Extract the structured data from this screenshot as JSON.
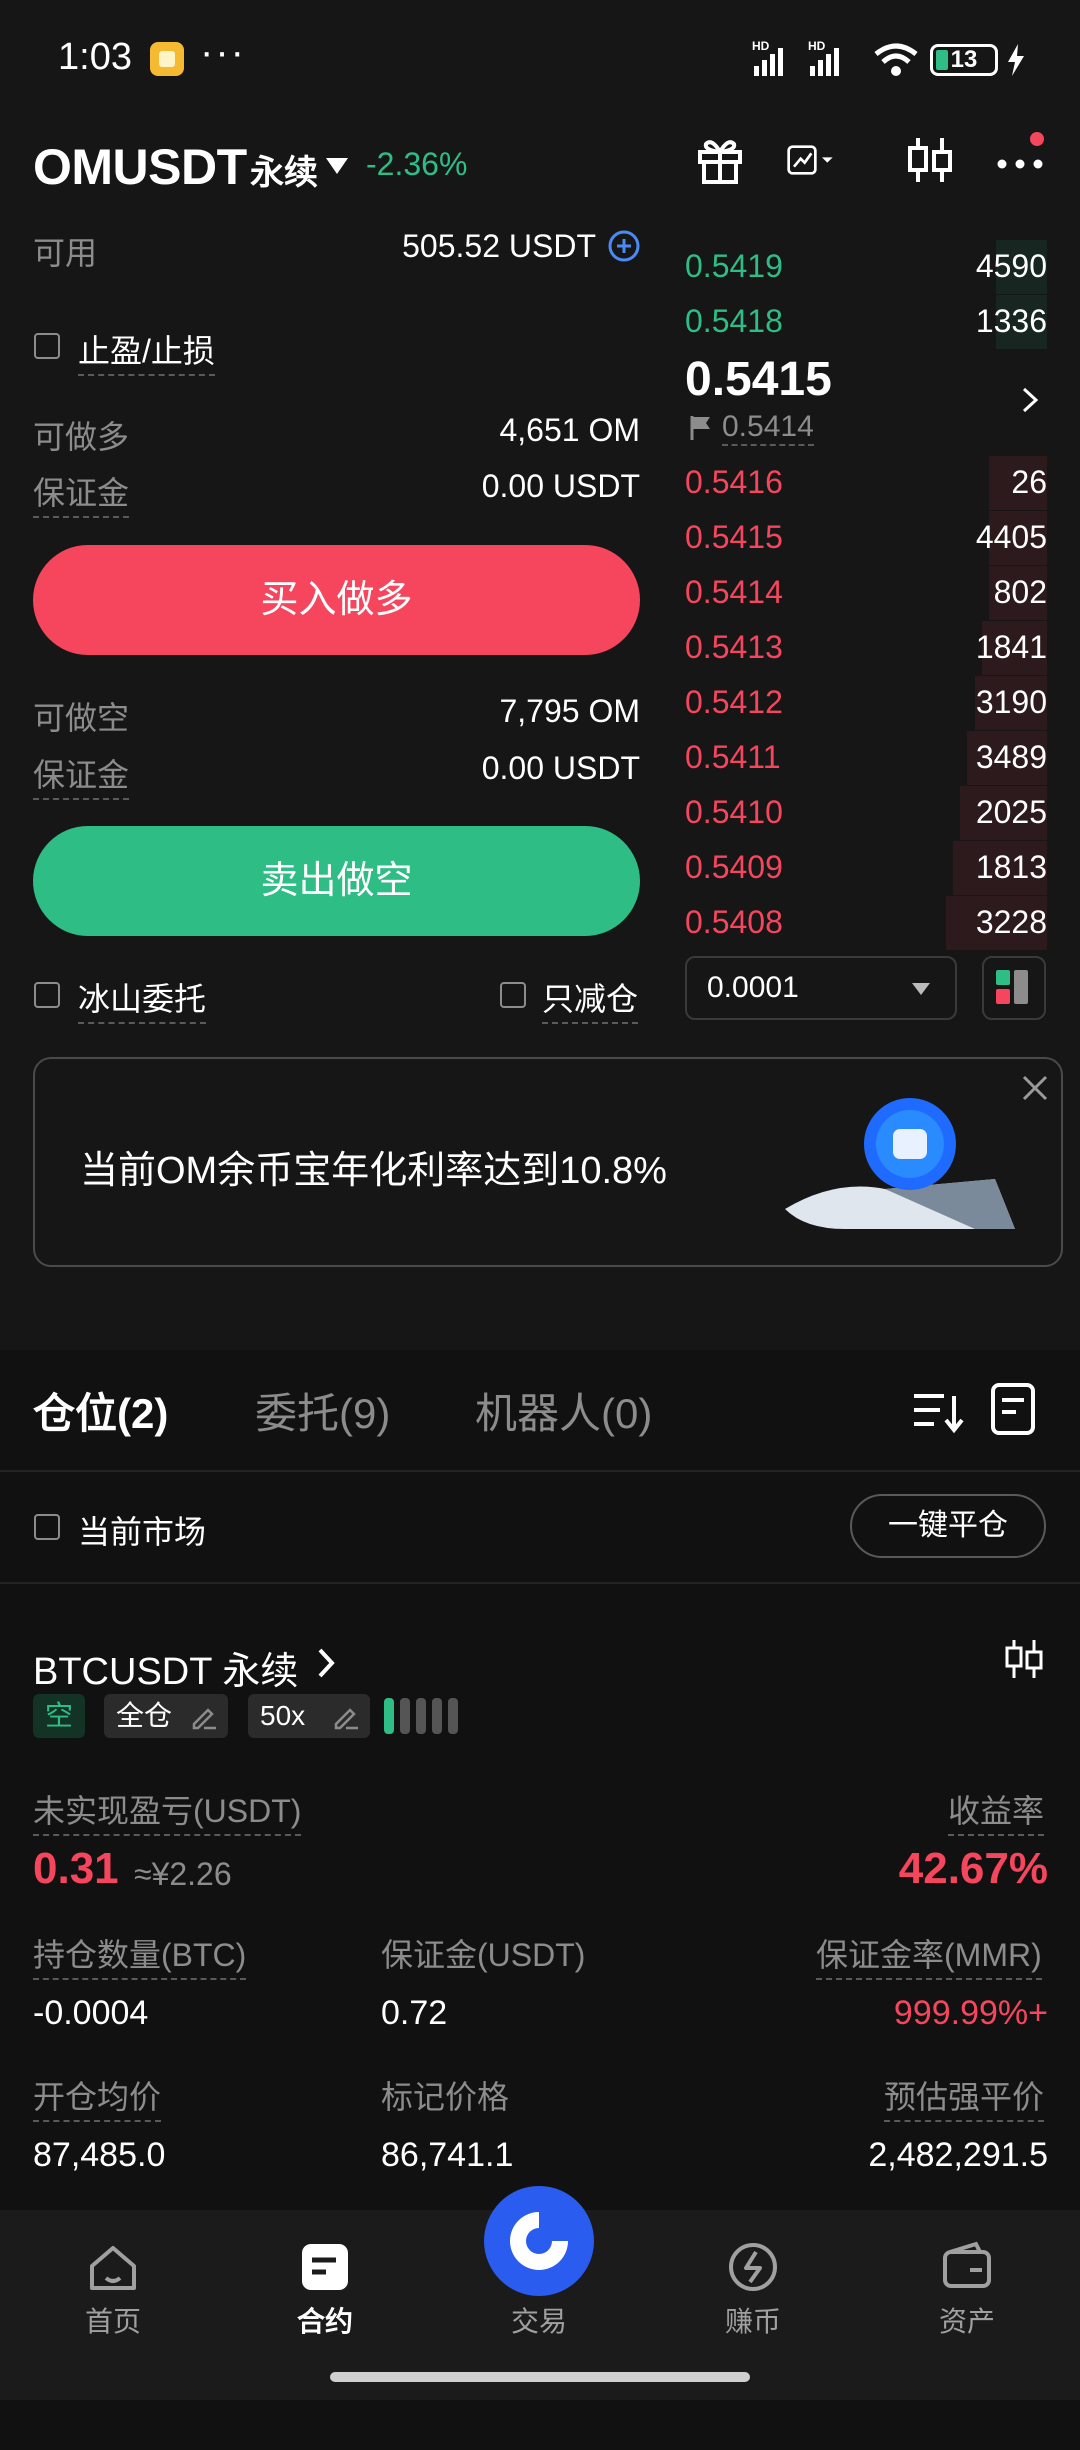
{
  "status_bar": {
    "time": "1:03",
    "dots": "···",
    "battery": "13"
  },
  "header": {
    "pair": "OMUSDT",
    "type": "永续",
    "change": "-2.36%"
  },
  "form": {
    "available_label": "可用",
    "available_value": "505.52 USDT",
    "tp_sl_label": "止盈/止损",
    "long_label": "可做多",
    "long_value": "4,651 OM",
    "margin_label": "保证金",
    "margin_long_value": "0.00 USDT",
    "buy_label": "买入做多",
    "short_label": "可做空",
    "short_value": "7,795 OM",
    "margin_short_value": "0.00 USDT",
    "sell_label": "卖出做空",
    "iceberg_label": "冰山委托",
    "reduce_only_label": "只减仓"
  },
  "orderbook": {
    "asks": [
      {
        "price": "0.5419",
        "qty": "4590",
        "depth": 0.14
      },
      {
        "price": "0.5418",
        "qty": "1336",
        "depth": 0.14
      }
    ],
    "mid_price": "0.5415",
    "mark_price": "0.5414",
    "bids": [
      {
        "price": "0.5416",
        "qty": "26",
        "depth": 0.16
      },
      {
        "price": "0.5415",
        "qty": "4405",
        "depth": 0.16
      },
      {
        "price": "0.5414",
        "qty": "802",
        "depth": 0.16
      },
      {
        "price": "0.5413",
        "qty": "1841",
        "depth": 0.18
      },
      {
        "price": "0.5412",
        "qty": "3190",
        "depth": 0.2
      },
      {
        "price": "0.5411",
        "qty": "3489",
        "depth": 0.22
      },
      {
        "price": "0.5410",
        "qty": "2025",
        "depth": 0.24
      },
      {
        "price": "0.5409",
        "qty": "1813",
        "depth": 0.26
      },
      {
        "price": "0.5408",
        "qty": "3228",
        "depth": 0.28
      }
    ],
    "precision": "0.0001"
  },
  "banner": {
    "text": "当前OM余币宝年化利率达到10.8%"
  },
  "tabs": {
    "positions": "仓位(2)",
    "orders": "委托(9)",
    "bots": "机器人(0)"
  },
  "filter": {
    "current_market": "当前市场",
    "close_all": "一键平仓"
  },
  "position": {
    "symbol": "BTCUSDT 永续",
    "side_tag": "空",
    "margin_mode": "全仓",
    "leverage": "50x",
    "unrealized_label": "未实现盈亏(USDT)",
    "unrealized_value": "0.31",
    "unrealized_cny": "≈¥2.26",
    "roe_label": "收益率",
    "roe_value": "42.67%",
    "size_label": "持仓数量(BTC)",
    "size_value": "-0.0004",
    "margin_label": "保证金(USDT)",
    "margin_value": "0.72",
    "mmr_label": "保证金率(MMR)",
    "mmr_value": "999.99%+",
    "entry_label": "开仓均价",
    "entry_value": "87,485.0",
    "mark_label": "标记价格",
    "mark_value": "86,741.1",
    "liq_label": "预估强平价",
    "liq_value": "2,482,291.5"
  },
  "nav": {
    "home": "首页",
    "futures": "合约",
    "trade": "交易",
    "earn": "赚币",
    "assets": "资产"
  },
  "colors": {
    "green": "#2ebd85",
    "red": "#f6465d",
    "blue": "#2a5cf0"
  }
}
